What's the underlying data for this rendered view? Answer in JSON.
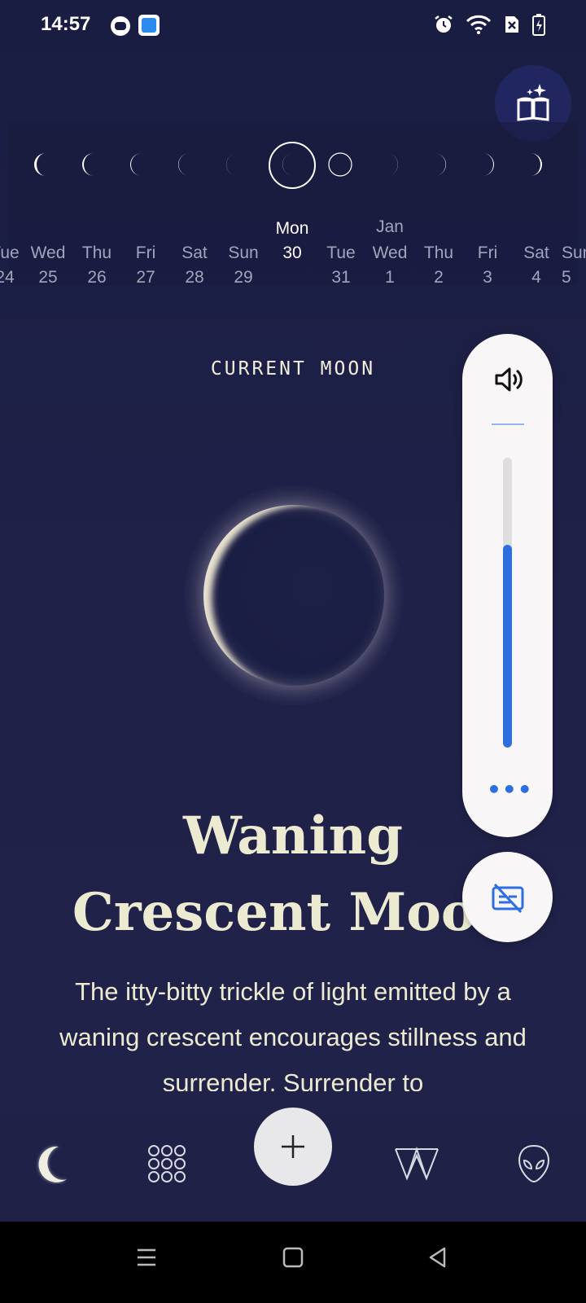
{
  "status_bar": {
    "time": "14:57",
    "icons": [
      "app-notification-icon",
      "app-notification-icon-2",
      "alarm-icon",
      "wifi-icon",
      "no-sim-icon",
      "battery-charging-icon"
    ]
  },
  "header": {
    "journal_icon": "book-sparkle-icon"
  },
  "calendar": {
    "month_marker": "Jan",
    "days": [
      {
        "weekday": "Tue",
        "date": "24"
      },
      {
        "weekday": "Wed",
        "date": "25"
      },
      {
        "weekday": "Thu",
        "date": "26"
      },
      {
        "weekday": "Fri",
        "date": "27"
      },
      {
        "weekday": "Sat",
        "date": "28"
      },
      {
        "weekday": "Sun",
        "date": "29"
      },
      {
        "weekday": "Mon",
        "date": "30"
      },
      {
        "weekday": "Tue",
        "date": "31"
      },
      {
        "weekday": "Wed",
        "date": "1"
      },
      {
        "weekday": "Thu",
        "date": "2"
      },
      {
        "weekday": "Fri",
        "date": "3"
      },
      {
        "weekday": "Sat",
        "date": "4"
      },
      {
        "weekday": "Sun",
        "date": "5"
      }
    ],
    "selected_index": 6
  },
  "current": {
    "label": "CURRENT MOON",
    "phase_title_line1": "Waning",
    "phase_title_line2": "Crescent Moon",
    "description": "The itty-bitty trickle of light emitted by a waning crescent encourages stillness and surrender. Surrender to"
  },
  "volume": {
    "level_percent": 70,
    "more_label": "•••",
    "accent": "#2e6fe0"
  },
  "nav": {
    "items": [
      "moon-icon",
      "grid-icon",
      "add-icon",
      "tarot-icon",
      "alien-icon"
    ]
  },
  "colors": {
    "background": "#1f2148",
    "text": "#ecebd2",
    "accent": "#2e6fe0"
  }
}
